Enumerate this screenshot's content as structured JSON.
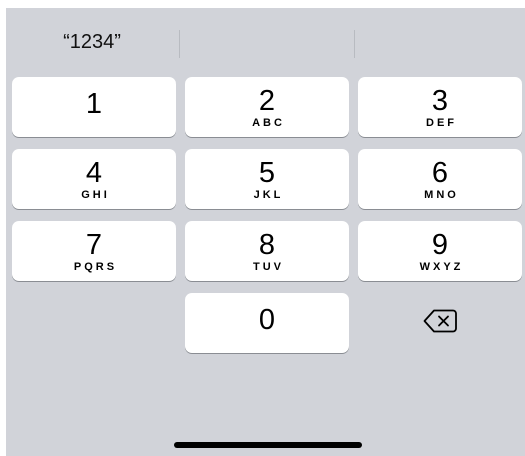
{
  "suggestions": {
    "items": [
      "“1234”",
      "",
      ""
    ]
  },
  "keypad": {
    "keys": [
      {
        "digit": "1",
        "letters": ""
      },
      {
        "digit": "2",
        "letters": "ABC"
      },
      {
        "digit": "3",
        "letters": "DEF"
      },
      {
        "digit": "4",
        "letters": "GHI"
      },
      {
        "digit": "5",
        "letters": "JKL"
      },
      {
        "digit": "6",
        "letters": "MNO"
      },
      {
        "digit": "7",
        "letters": "PQRS"
      },
      {
        "digit": "8",
        "letters": "TUV"
      },
      {
        "digit": "9",
        "letters": "WXYZ"
      },
      {
        "digit": "0",
        "letters": ""
      }
    ],
    "delete_icon": "backspace-icon"
  },
  "colors": {
    "keyboard_background": "#d1d3d9",
    "key_background": "#ffffff",
    "key_shadow": "#8a8d93"
  }
}
